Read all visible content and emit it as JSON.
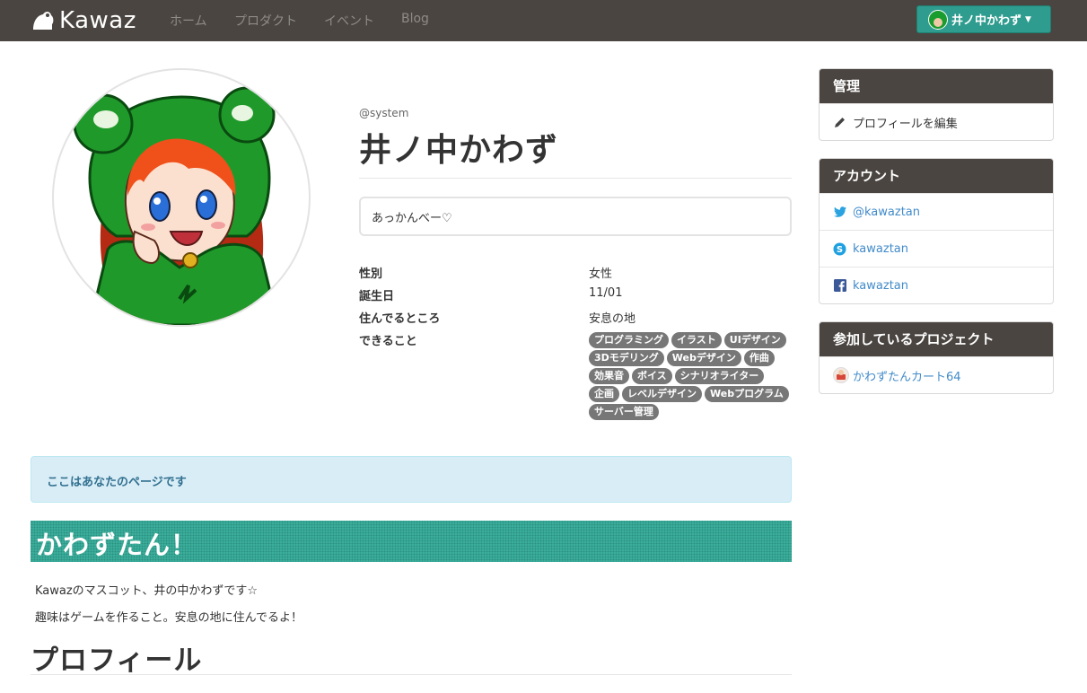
{
  "navbar": {
    "brand": "Kawaz",
    "links": [
      "ホーム",
      "プロダクト",
      "イベント",
      "Blog"
    ],
    "user_name": "井ノ中かわず"
  },
  "profile": {
    "screen_name": "@system",
    "display_name": "井ノ中かわず",
    "quote": "あっかんべー♡",
    "info": [
      {
        "label": "性別",
        "value": "女性"
      },
      {
        "label": "誕生日",
        "value": "11/01"
      },
      {
        "label": "住んでるところ",
        "value": "安息の地"
      },
      {
        "label": "できること",
        "value": ""
      }
    ],
    "skills": [
      "プログラミング",
      "イラスト",
      "UIデザイン",
      "3Dモデリング",
      "Webデザイン",
      "作曲",
      "効果音",
      "ボイス",
      "シナリオライター",
      "企画",
      "レベルデザイン",
      "Webプログラム",
      "サーバー管理"
    ]
  },
  "alert": "ここはあなたのページです",
  "banner": "かわずたん！",
  "paragraphs": [
    "Kawazのマスコット、井の中かわずです☆",
    "趣味はゲームを作ること。安息の地に住んでるよ！"
  ],
  "section_heading": "プロフィール",
  "sidebar": {
    "admin": {
      "title": "管理",
      "edit_label": "プロフィールを編集"
    },
    "accounts": {
      "title": "アカウント",
      "twitter": "@kawaztan",
      "skype": "kawaztan",
      "facebook": "kawaztan"
    },
    "projects": {
      "title": "参加しているプロジェクト",
      "items": [
        "かわずたんカート64"
      ]
    }
  },
  "colors": {
    "navbar": "#4a4541",
    "accent": "#2e9c8e",
    "banner": "#3fb3a0",
    "link": "#428bca"
  }
}
